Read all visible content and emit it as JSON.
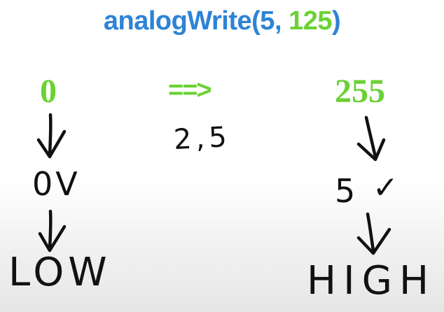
{
  "title": {
    "func": "analogWrite(",
    "pin": "5",
    "sep": ", ",
    "value": "125",
    "close": ")"
  },
  "left": {
    "label": "0",
    "voltage": "0V",
    "state": "LOW"
  },
  "middle": {
    "arrow": "==>",
    "handwritten": "2,5"
  },
  "right": {
    "label": "255",
    "voltage": "5",
    "check": "✓",
    "state": "HIGH"
  },
  "colors": {
    "title_blue": "#2d83d6",
    "accent_green": "#6ad233",
    "ink": "#111111",
    "background": "#ffffff"
  },
  "icons": {
    "down_arrow": "down-arrow-icon",
    "check": "check-icon"
  }
}
